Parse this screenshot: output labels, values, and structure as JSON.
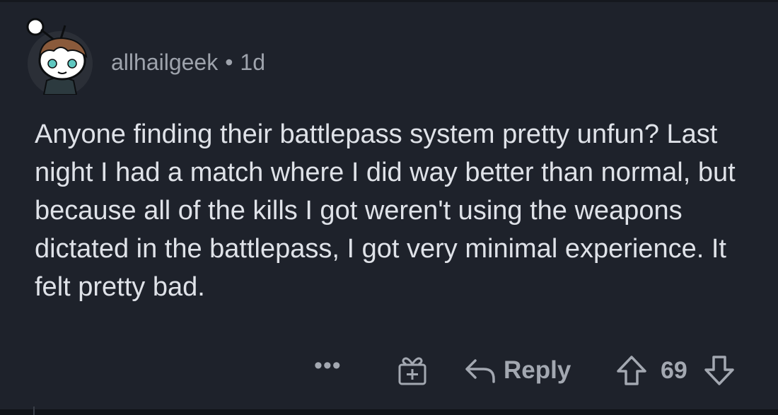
{
  "comment": {
    "author": "allhailgeek",
    "separator": "•",
    "age": "1d",
    "body": "Anyone finding their battlepass system pretty unfun? Last night I had a match where I did way better than normal, but because all of the kills I got weren't using the weapons dictated in the battlepass, I got very minimal experience. It felt pretty bad."
  },
  "actions": {
    "more": "•••",
    "reply_label": "Reply",
    "score": "69"
  },
  "icons": {
    "more": "more-options-icon",
    "award": "award-gift-icon",
    "reply": "reply-arrow-icon",
    "upvote": "upvote-arrow-icon",
    "downvote": "downvote-arrow-icon"
  },
  "colors": {
    "background": "#1e222b",
    "text": "#dfe2e8",
    "muted": "#a3a8b1",
    "avatar_hair": "#8a5a3b",
    "avatar_eye": "#5fc7c0"
  }
}
